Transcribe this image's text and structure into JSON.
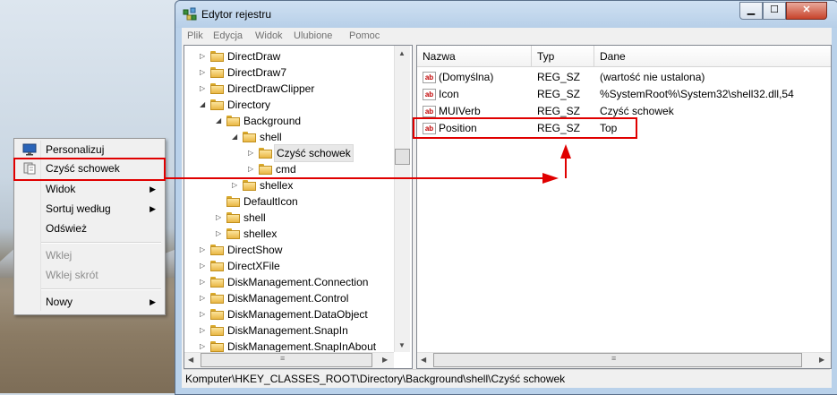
{
  "context_menu": {
    "items": [
      {
        "label": "Personalizuj",
        "icon": "monitor-icon",
        "disabled": false,
        "submenu": false
      },
      {
        "label": "Czyść schowek",
        "icon": "clipboard-icon",
        "disabled": false,
        "submenu": false
      },
      {
        "label": "Widok",
        "disabled": false,
        "submenu": true
      },
      {
        "label": "Sortuj według",
        "disabled": false,
        "submenu": true
      },
      {
        "label": "Odśwież",
        "disabled": false,
        "submenu": false
      },
      {
        "label": "Wklej",
        "disabled": true,
        "submenu": false
      },
      {
        "label": "Wklej skrót",
        "disabled": true,
        "submenu": false
      },
      {
        "label": "Nowy",
        "disabled": false,
        "submenu": true
      }
    ]
  },
  "window": {
    "title": "Edytor rejestru",
    "icon": "regedit-icon",
    "caption": {
      "minimize": "▁",
      "maximize": "☐",
      "close": "✕"
    }
  },
  "menubar": [
    "Plik",
    "Edycja",
    "Widok",
    "Ulubione",
    "Pomoc"
  ],
  "tree": {
    "items": [
      {
        "label": "DirectDraw",
        "expander": "▷"
      },
      {
        "label": "DirectDraw7",
        "expander": "▷"
      },
      {
        "label": "DirectDrawClipper",
        "expander": "▷"
      },
      {
        "label": "Directory",
        "expander": "◢"
      },
      {
        "label": "Background",
        "expander": "◢"
      },
      {
        "label": "shell",
        "expander": "◢"
      },
      {
        "label": "Czyść schowek",
        "expander": "▷"
      },
      {
        "label": "cmd",
        "expander": "▷"
      },
      {
        "label": "shellex",
        "expander": "▷"
      },
      {
        "label": "DefaultIcon",
        "expander": ""
      },
      {
        "label": "shell",
        "expander": "▷"
      },
      {
        "label": "shellex",
        "expander": "▷"
      },
      {
        "label": "DirectShow",
        "expander": "▷"
      },
      {
        "label": "DirectXFile",
        "expander": "▷"
      },
      {
        "label": "DiskManagement.Connection",
        "expander": "▷"
      },
      {
        "label": "DiskManagement.Control",
        "expander": "▷"
      },
      {
        "label": "DiskManagement.DataObject",
        "expander": "▷"
      },
      {
        "label": "DiskManagement.SnapIn",
        "expander": "▷"
      },
      {
        "label": "DiskManagement.SnapInAbout",
        "expander": "▷"
      }
    ]
  },
  "list": {
    "columns": [
      "Nazwa",
      "Typ",
      "Dane"
    ],
    "rows": [
      {
        "name": "(Domyślna)",
        "type": "REG_SZ",
        "data": "(wartość nie ustalona)"
      },
      {
        "name": "Icon",
        "type": "REG_SZ",
        "data": "%SystemRoot%\\System32\\shell32.dll,54"
      },
      {
        "name": "MUIVerb",
        "type": "REG_SZ",
        "data": "Czyść schowek"
      },
      {
        "name": "Position",
        "type": "REG_SZ",
        "data": "Top"
      }
    ],
    "value_icon_text": "ab"
  },
  "statusbar": "Komputer\\HKEY_CLASSES_ROOT\\Directory\\Background\\shell\\Czyść schowek",
  "scroll": {
    "up": "▲",
    "down": "▼",
    "left": "◀",
    "right": "▶",
    "grip": "≡"
  },
  "colors": {
    "highlight": "#e00000"
  }
}
